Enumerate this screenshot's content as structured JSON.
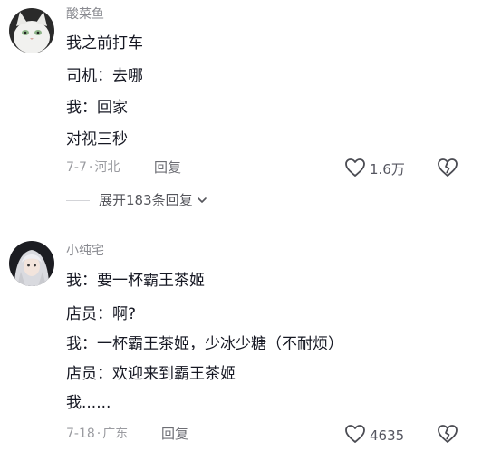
{
  "comments": [
    {
      "username": "酸菜鱼",
      "lines": [
        "我之前打车",
        "司机：去哪",
        "我：回家",
        "对视三秒"
      ],
      "date": "7-7",
      "separator": "·",
      "location": "河北",
      "reply_label": "回复",
      "like_count": "1.6万",
      "avatar": "cat-avatar",
      "replies_expand_label": "展开183条回复"
    },
    {
      "username": "小纯宅",
      "lines": [
        "我：要一杯霸王茶姬",
        "店员：啊?",
        "我：一杯霸王茶姬，少冰少糖（不耐烦）",
        "店员：欢迎来到霸王茶姬",
        "我......"
      ],
      "date": "7-18",
      "separator": "·",
      "location": "广东",
      "reply_label": "回复",
      "like_count": "4635",
      "avatar": "anime-girl-avatar"
    }
  ],
  "colors": {
    "text_primary": "#161823",
    "text_secondary": "#8a8b91",
    "icon": "#4a4b52"
  },
  "icons": [
    "heart-outline-icon",
    "broken-heart-icon",
    "chevron-down-icon"
  ]
}
